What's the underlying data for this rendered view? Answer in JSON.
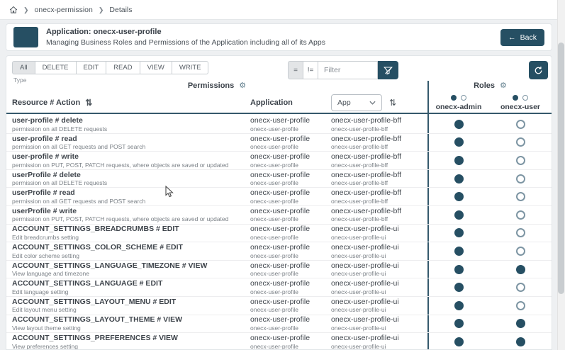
{
  "colors": {
    "accent": "#264f63",
    "separator": "#35596c"
  },
  "icons": {
    "gear": "⚙",
    "sort": "⇅",
    "back_arrow": "←"
  },
  "breadcrumb": {
    "items": [
      "onecx-permission",
      "Details"
    ]
  },
  "header": {
    "title": "Application: onecx-user-profile",
    "subtitle": "Managing Business Roles and Permissions of the Application including all of its Apps",
    "back_label": "Back"
  },
  "filters": {
    "type_chips": [
      "All",
      "DELETE",
      "EDIT",
      "READ",
      "VIEW",
      "WRITE"
    ],
    "selected_chip": "All",
    "type_label": "Type",
    "eq_label": "=",
    "neq_label": "!=",
    "filter_placeholder": "Filter",
    "filter_value": ""
  },
  "table": {
    "permissions_title": "Permissions",
    "roles_title": "Roles",
    "columns": {
      "resource_action": "Resource # Action",
      "application": "Application",
      "app_dropdown": "App"
    },
    "roles": [
      "onecx-admin",
      "onecx-user"
    ],
    "rows": [
      {
        "title": "user-profile # delete",
        "desc": "permission on all DELETE requests",
        "application": "onecx-user-profile",
        "application_sub": "onecx-user-profile",
        "app": "onecx-user-profile-bff",
        "app_sub": "onecx-user-profile-bff",
        "role_values": [
          true,
          false
        ]
      },
      {
        "title": "user-profile # read",
        "desc": "permission on all GET requests and POST search",
        "application": "onecx-user-profile",
        "application_sub": "onecx-user-profile",
        "app": "onecx-user-profile-bff",
        "app_sub": "onecx-user-profile-bff",
        "role_values": [
          true,
          false
        ]
      },
      {
        "title": "user-profile # write",
        "desc": "permission on PUT, POST, PATCH requests, where objects are saved or updated",
        "application": "onecx-user-profile",
        "application_sub": "onecx-user-profile",
        "app": "onecx-user-profile-bff",
        "app_sub": "onecx-user-profile-bff",
        "role_values": [
          true,
          false
        ]
      },
      {
        "title": "userProfile # delete",
        "desc": "permission on all DELETE requests",
        "application": "onecx-user-profile",
        "application_sub": "onecx-user-profile",
        "app": "onecx-user-profile-bff",
        "app_sub": "onecx-user-profile-bff",
        "role_values": [
          true,
          false
        ]
      },
      {
        "title": "userProfile # read",
        "desc": "permission on all GET requests and POST search",
        "application": "onecx-user-profile",
        "application_sub": "onecx-user-profile",
        "app": "onecx-user-profile-bff",
        "app_sub": "onecx-user-profile-bff",
        "role_values": [
          true,
          false
        ]
      },
      {
        "title": "userProfile # write",
        "desc": "permission on PUT, POST, PATCH requests, where objects are saved or updated",
        "application": "onecx-user-profile",
        "application_sub": "onecx-user-profile",
        "app": "onecx-user-profile-bff",
        "app_sub": "onecx-user-profile-bff",
        "role_values": [
          true,
          false
        ]
      },
      {
        "title": "ACCOUNT_SETTINGS_BREADCRUMBS # EDIT",
        "desc": "Edit breadcrumbs setting",
        "application": "onecx-user-profile",
        "application_sub": "onecx-user-profile",
        "app": "onecx-user-profile-ui",
        "app_sub": "onecx-user-profile-ui",
        "role_values": [
          true,
          false
        ]
      },
      {
        "title": "ACCOUNT_SETTINGS_COLOR_SCHEME # EDIT",
        "desc": "Edit color scheme setting",
        "application": "onecx-user-profile",
        "application_sub": "onecx-user-profile",
        "app": "onecx-user-profile-ui",
        "app_sub": "onecx-user-profile-ui",
        "role_values": [
          true,
          false
        ]
      },
      {
        "title": "ACCOUNT_SETTINGS_LANGUAGE_TIMEZONE # VIEW",
        "desc": "View language and timezone",
        "application": "onecx-user-profile",
        "application_sub": "onecx-user-profile",
        "app": "onecx-user-profile-ui",
        "app_sub": "onecx-user-profile-ui",
        "role_values": [
          true,
          true
        ]
      },
      {
        "title": "ACCOUNT_SETTINGS_LANGUAGE # EDIT",
        "desc": "Edit language setting",
        "application": "onecx-user-profile",
        "application_sub": "onecx-user-profile",
        "app": "onecx-user-profile-ui",
        "app_sub": "onecx-user-profile-ui",
        "role_values": [
          true,
          false
        ]
      },
      {
        "title": "ACCOUNT_SETTINGS_LAYOUT_MENU # EDIT",
        "desc": "Edit layout menu setting",
        "application": "onecx-user-profile",
        "application_sub": "onecx-user-profile",
        "app": "onecx-user-profile-ui",
        "app_sub": "onecx-user-profile-ui",
        "role_values": [
          true,
          false
        ]
      },
      {
        "title": "ACCOUNT_SETTINGS_LAYOUT_THEME # VIEW",
        "desc": "View layout theme setting",
        "application": "onecx-user-profile",
        "application_sub": "onecx-user-profile",
        "app": "onecx-user-profile-ui",
        "app_sub": "onecx-user-profile-ui",
        "role_values": [
          true,
          true
        ]
      },
      {
        "title": "ACCOUNT_SETTINGS_PREFERENCES # VIEW",
        "desc": "View preferences setting",
        "application": "onecx-user-profile",
        "application_sub": "onecx-user-profile",
        "app": "onecx-user-profile-ui",
        "app_sub": "onecx-user-profile-ui",
        "role_values": [
          true,
          true
        ]
      }
    ]
  }
}
